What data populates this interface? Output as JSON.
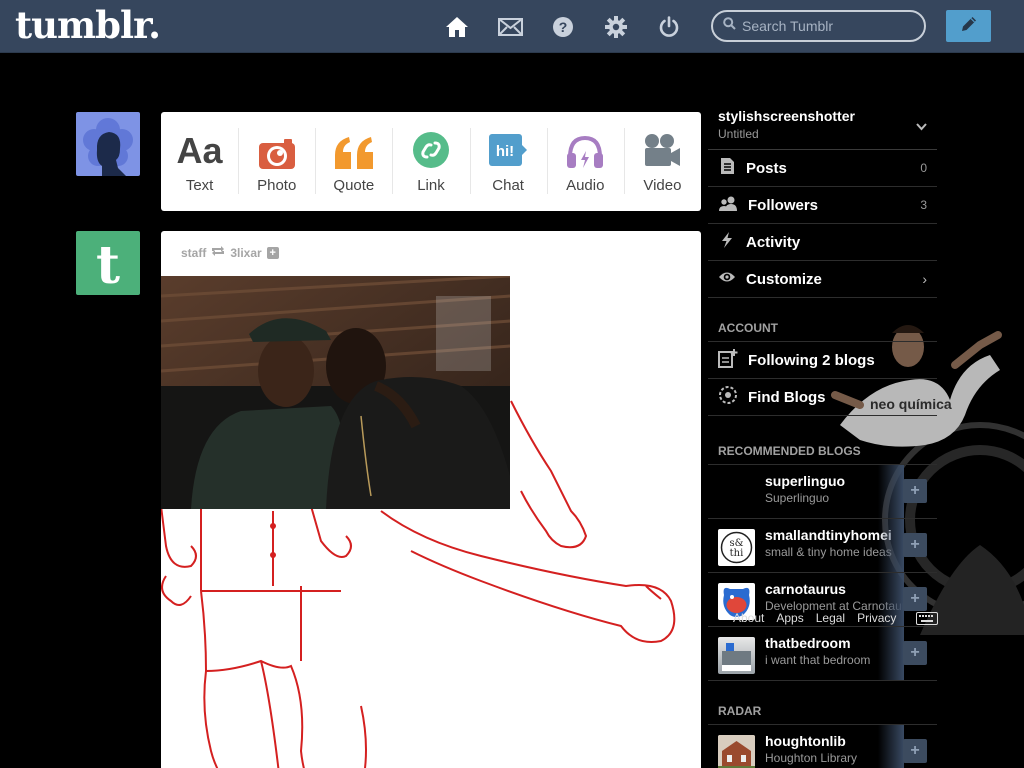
{
  "header": {
    "logo": "tumblr.",
    "search_placeholder": "Search Tumblr"
  },
  "post_types": [
    {
      "label": "Text",
      "icon": "text-icon",
      "color": "#444444"
    },
    {
      "label": "Photo",
      "icon": "camera-icon",
      "color": "#d95e40"
    },
    {
      "label": "Quote",
      "icon": "quote-icon",
      "color": "#f2992e"
    },
    {
      "label": "Link",
      "icon": "link-icon",
      "color": "#56bc8a"
    },
    {
      "label": "Chat",
      "icon": "chat-icon",
      "color": "#529ecc"
    },
    {
      "label": "Audio",
      "icon": "headphones-icon",
      "color": "#a77dc2"
    },
    {
      "label": "Video",
      "icon": "video-camera-icon",
      "color": "#748089"
    }
  ],
  "post": {
    "author": "staff",
    "reblogged_from": "3lixar"
  },
  "sidebar": {
    "blog_name": "stylishscreenshotter",
    "blog_title": "Untitled",
    "menu": [
      {
        "label": "Posts",
        "count": "0"
      },
      {
        "label": "Followers",
        "count": "3"
      },
      {
        "label": "Activity",
        "count": ""
      },
      {
        "label": "Customize",
        "count": ""
      }
    ],
    "account_header": "ACCOUNT",
    "account_items": [
      {
        "label": "Following 2 blogs"
      },
      {
        "label": "Find Blogs"
      }
    ],
    "recommended_header": "RECOMMENDED BLOGS",
    "recommended": [
      {
        "name": "superlinguo",
        "desc": "Superlinguo"
      },
      {
        "name": "smallandtinyhomei",
        "desc": "small & tiny home ideas"
      },
      {
        "name": "carnotaurus",
        "desc": "Development at Carnotaurus"
      },
      {
        "name": "thatbedroom",
        "desc": "i want that bedroom"
      }
    ],
    "radar_header": "RADAR",
    "radar": [
      {
        "name": "houghtonlib",
        "desc": "Houghton Library"
      }
    ],
    "footer_links": [
      "About",
      "Apps",
      "Legal",
      "Privacy"
    ]
  }
}
